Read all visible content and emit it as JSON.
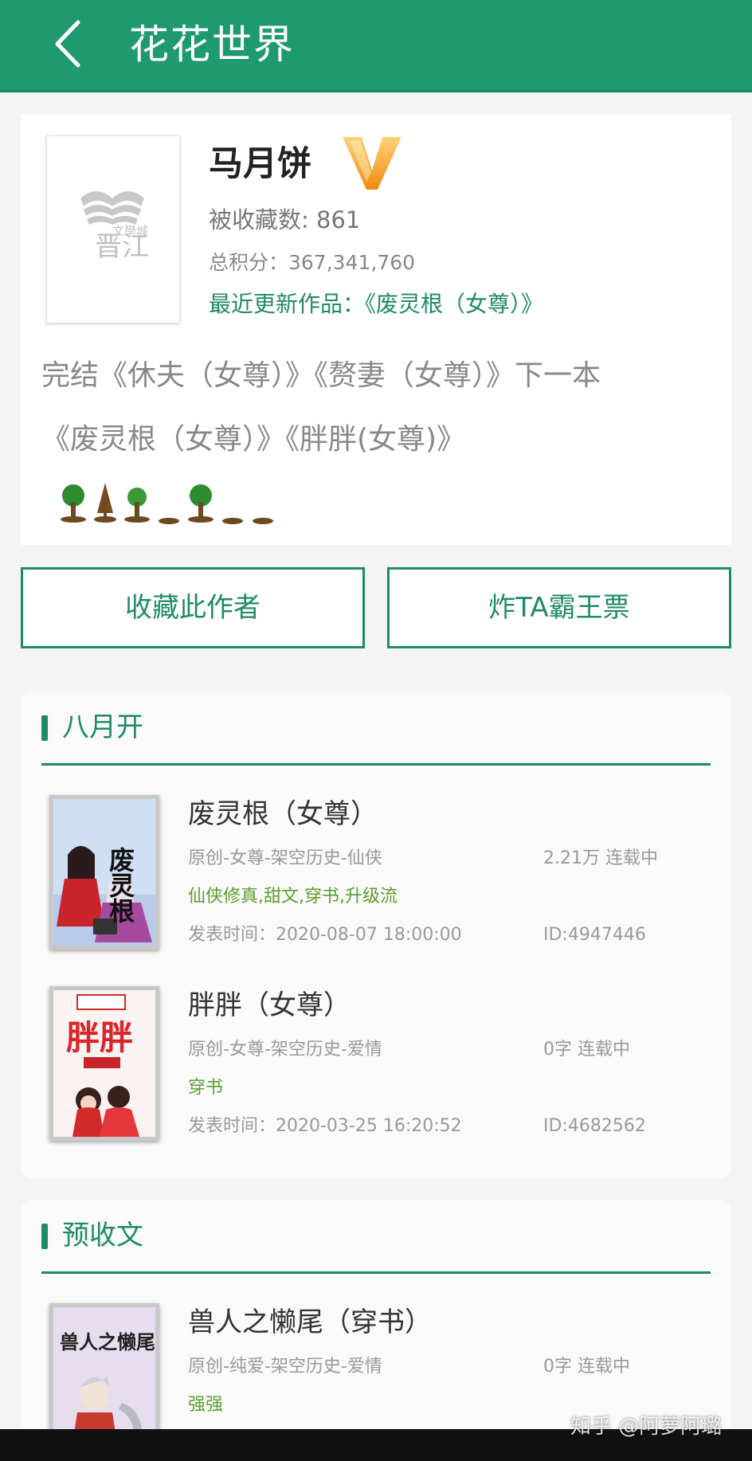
{
  "header": {
    "title": "花花世界"
  },
  "author": {
    "name": "马月饼",
    "favorites": "被收藏数: 861",
    "score": "总积分：367,341,760",
    "recent_work": "最近更新作品：《废灵根（女尊）》",
    "intro_line1": "完结《休夫（女尊）》《赘妻（女尊）》下一本",
    "intro_line2": "《废灵根（女尊）》《胖胖(女尊)》"
  },
  "buttons": {
    "follow": "收藏此作者",
    "bomb": "炸TA霸王票"
  },
  "sections": [
    {
      "title": "八月开",
      "books": [
        {
          "title": "废灵根（女尊）",
          "genre": "原创-女尊-架空历史-仙侠",
          "stats": "2.21万  连载中",
          "tags": "仙侠修真,甜文,穿书,升级流",
          "date": "发表时间：2020-08-07 18:00:00",
          "id": "ID:4947446",
          "cover_text": "废灵根"
        },
        {
          "title": "胖胖（女尊）",
          "genre": "原创-女尊-架空历史-爱情",
          "stats": "0字  连载中",
          "tags": "穿书",
          "date": "发表时间：2020-03-25 16:20:52",
          "id": "ID:4682562",
          "cover_text": "胖胖"
        }
      ]
    },
    {
      "title": "预收文",
      "books": [
        {
          "title": "兽人之懒尾（穿书）",
          "genre": "原创-纯爱-架空历史-爱情",
          "stats": "0字  连载中",
          "tags": "强强",
          "cover_text": "兽人之懒尾"
        }
      ]
    }
  ],
  "watermark": "知乎 @阿萝阿璐",
  "colors": {
    "brand": "#1f9a6e",
    "accent": "#1f8b64",
    "tag": "#5aa02c"
  }
}
